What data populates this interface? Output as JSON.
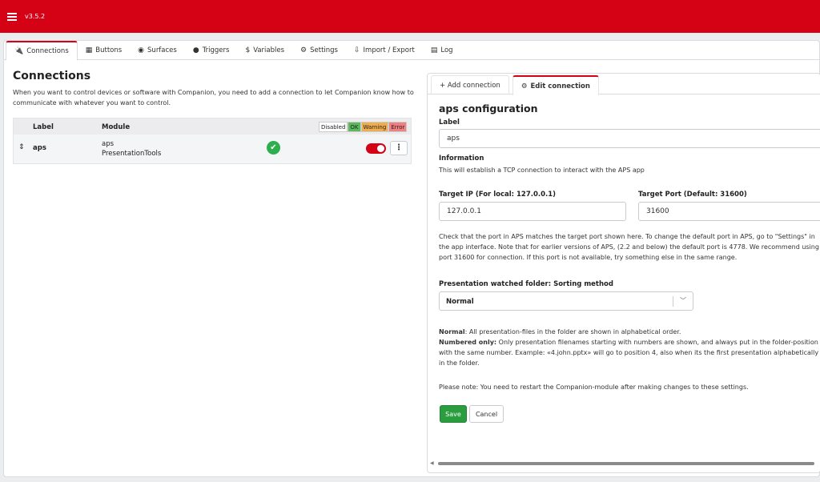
{
  "app": {
    "version": "v3.5.2"
  },
  "nav": {
    "tabs": [
      {
        "icon": "plug-icon",
        "glyph": "🔌",
        "label": "Connections"
      },
      {
        "icon": "grid-icon",
        "glyph": "▦",
        "label": "Buttons"
      },
      {
        "icon": "gamepad-icon",
        "glyph": "◉",
        "label": "Surfaces"
      },
      {
        "icon": "clock-icon",
        "glyph": "●",
        "label": "Triggers"
      },
      {
        "icon": "dollar-icon",
        "glyph": "$",
        "label": "Variables"
      },
      {
        "icon": "gear-icon",
        "glyph": "⚙",
        "label": "Settings"
      },
      {
        "icon": "file-import-icon",
        "glyph": "⇩",
        "label": "Import / Export"
      },
      {
        "icon": "clipboard-icon",
        "glyph": "▤",
        "label": "Log"
      }
    ]
  },
  "connections": {
    "title": "Connections",
    "description": "When you want to control devices or software with Companion, you need to add a connection to let Companion know how to communicate with whatever you want to control.",
    "table": {
      "col_label": "Label",
      "col_module": "Module",
      "legend": {
        "disabled": "Disabled",
        "ok": "OK",
        "warning": "Warning",
        "error": "Error"
      },
      "rows": [
        {
          "label": "aps",
          "module_line1": "aps",
          "module_line2": "PresentationTools",
          "status_glyph": "✔"
        }
      ],
      "kebab_glyph": "⋮",
      "sort_glyph": "⇕"
    }
  },
  "editor": {
    "tab_add": "+ Add connection",
    "tab_edit": "Edit connection",
    "edit_glyph": "⚙",
    "title": "aps configuration",
    "help_glyph": "?",
    "label_heading": "Label",
    "label_value": "aps",
    "info_heading": "Information",
    "info_text": "This will establish a TCP connection to interact with the APS app",
    "target_ip_label": "Target IP (For local: 127.0.0.1)",
    "target_ip_value": "127.0.0.1",
    "target_port_label": "Target Port (Default: 31600)",
    "target_port_value": "31600",
    "port_note": "Check that the port in APS matches the target port shown here. To change the default port in APS, go to \"Settings\" in the app interface. Note that for earlier versions of APS, (2.2 and below) the default port is 4778. We recommend using port 31600 for connection. If this port is not available, try something else in the same range.",
    "sort_label": "Presentation watched folder: Sorting method",
    "sort_value": "Normal",
    "sort_chevron": "﹀",
    "normal_term": "Normal",
    "normal_text": ": All presentation-files in the folder are shown in alphabetical order.",
    "numbered_term": "Numbered only:",
    "numbered_text": " Only presentation filenames starting with numbers are shown, and always put in the folder-position with the same number. Example: «4.john.pptx» will go to position 4, also when its the first presentation alphabetically in the folder.",
    "restart_note": "Please note: You need to restart the Companion-module after making changes to these settings.",
    "save_label": "Save",
    "cancel_label": "Cancel"
  },
  "colors": {
    "brand": "#d50215",
    "ok": "#2eaf4e",
    "save": "#2a9d3e"
  }
}
